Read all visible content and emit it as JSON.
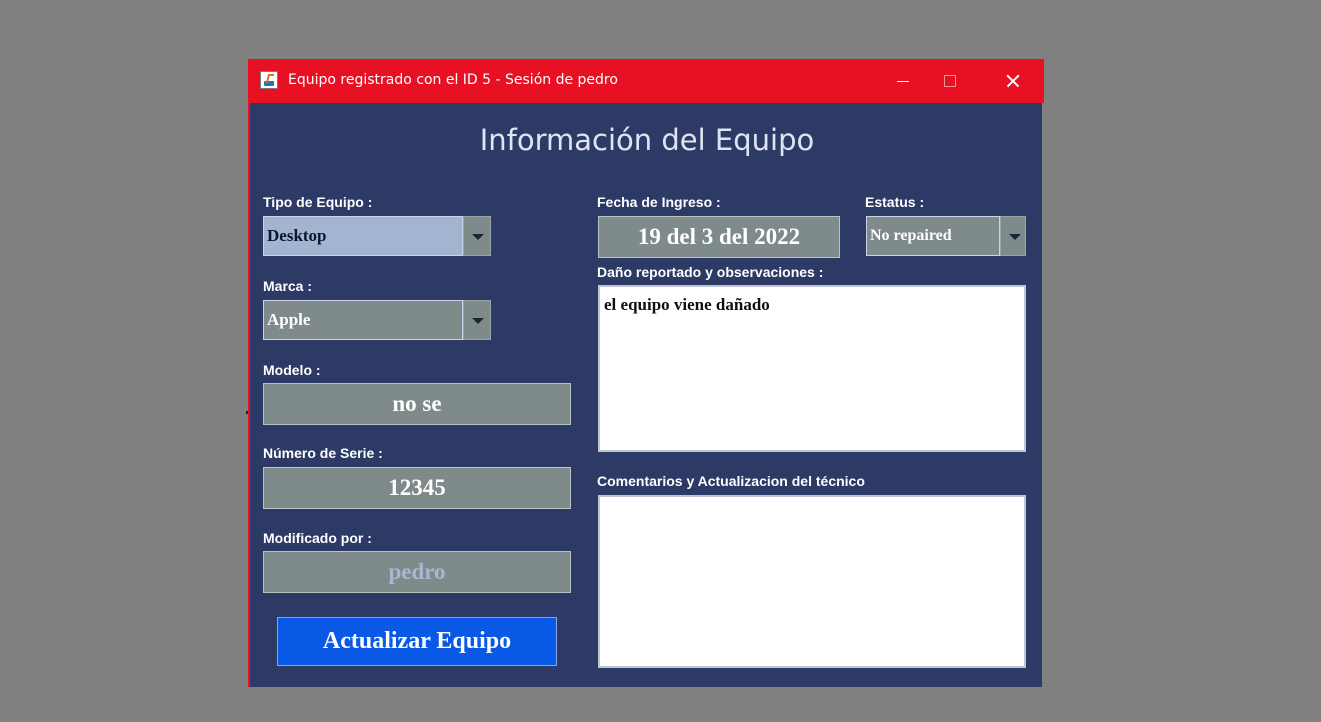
{
  "window": {
    "title": "Equipo registrado con el ID 5 - Sesión de pedro",
    "icon": "java-cup-icon",
    "accent_color": "#e81123",
    "background_color": "#2d3a66"
  },
  "heading": "Información del Equipo",
  "fields": {
    "tipo": {
      "label": "Tipo de Equipo :",
      "value": "Desktop"
    },
    "marca": {
      "label": "Marca :",
      "value": "Apple"
    },
    "modelo": {
      "label": "Modelo :",
      "value": "no se"
    },
    "serie": {
      "label": "Número de Serie :",
      "value": "12345"
    },
    "modificado": {
      "label": "Modificado por :",
      "value": "pedro"
    },
    "fecha": {
      "label": "Fecha de Ingreso :",
      "value": "19 del 3 del 2022"
    },
    "estatus": {
      "label": "Estatus :",
      "value": "No repaired"
    },
    "danio": {
      "label": "Daño reportado y observaciones :",
      "value": "el equipo viene dañado"
    },
    "comentarios": {
      "label": "Comentarios y Actualizacion del técnico",
      "value": ""
    }
  },
  "buttons": {
    "actualizar": "Actualizar Equipo"
  }
}
